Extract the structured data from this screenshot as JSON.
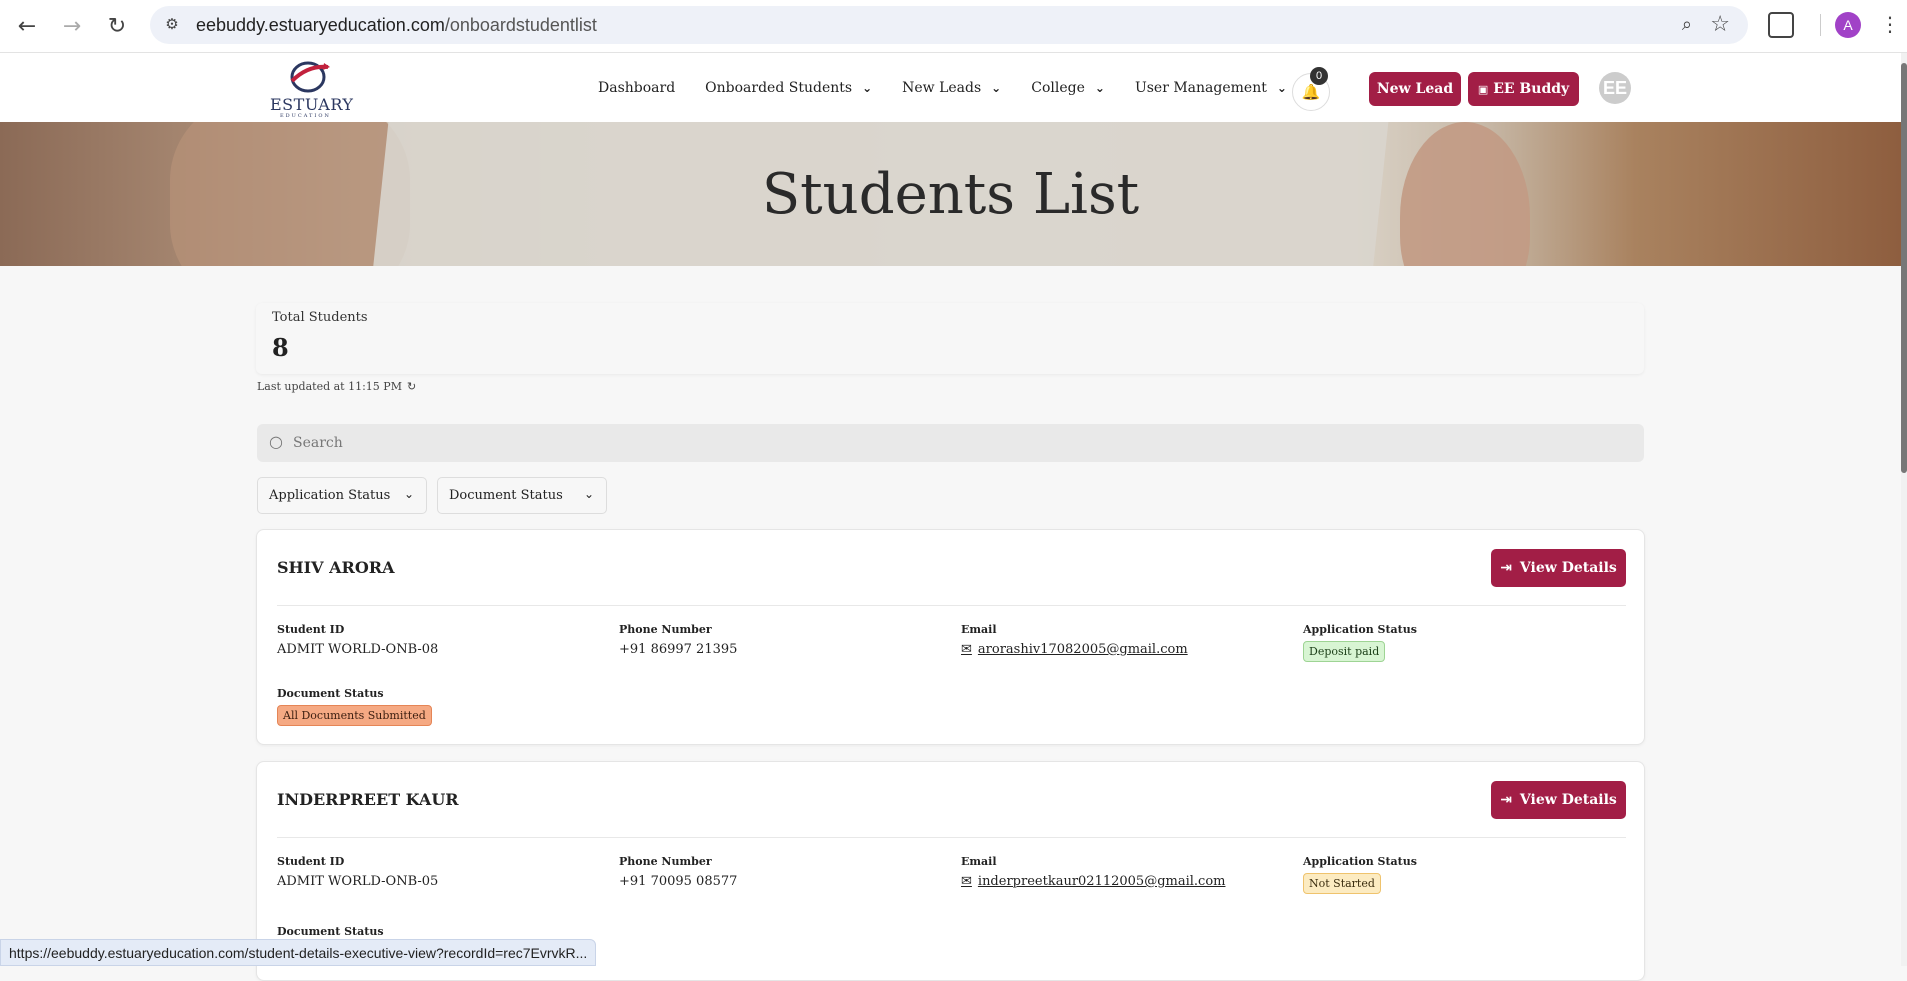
{
  "browser": {
    "url_domain": "eebuddy.estuaryeducation.com",
    "url_path": "/onboardstudentlist",
    "profile_initial": "A",
    "status_url": "https://eebuddy.estuaryeducation.com/student-details-executive-view?recordId=rec7EvrvkR..."
  },
  "header": {
    "logo_text": "ESTUARY",
    "logo_sub": "EDUCATION",
    "nav": [
      {
        "label": "Dashboard",
        "has_dropdown": false
      },
      {
        "label": "Onboarded Students",
        "has_dropdown": true
      },
      {
        "label": "New Leads",
        "has_dropdown": true
      },
      {
        "label": "College",
        "has_dropdown": true
      },
      {
        "label": "User Management",
        "has_dropdown": true
      }
    ],
    "notification_count": "0",
    "new_lead_label": "New Lead",
    "ee_buddy_label": "EE Buddy",
    "avatar_initials": "EE"
  },
  "hero": {
    "title": "Students List"
  },
  "stats": {
    "total_label": "Total Students",
    "total_value": "8",
    "last_updated": "Last updated at 11:15 PM"
  },
  "search": {
    "placeholder": "Search",
    "value": ""
  },
  "filters": {
    "application_status": "Application Status",
    "document_status": "Document Status"
  },
  "labels": {
    "student_id": "Student ID",
    "phone": "Phone Number",
    "email": "Email",
    "application_status": "Application Status",
    "document_status": "Document Status",
    "view_details": "View Details"
  },
  "students": [
    {
      "name": "SHIV ARORA",
      "student_id": "ADMIT WORLD-ONB-08",
      "phone": "+91 86997 21395",
      "email": "arorashiv17082005@gmail.com",
      "application_status": "Deposit paid",
      "document_status": "All Documents Submitted"
    },
    {
      "name": "INDERPREET KAUR",
      "student_id": "ADMIT WORLD-ONB-05",
      "phone": "+91 70095 08577",
      "email": "inderpreetkaur02112005@gmail.com",
      "application_status": "Not Started",
      "document_status": ""
    }
  ],
  "colors": {
    "brand": "#a21e46",
    "badge_green": "#d8f5d3",
    "badge_orange": "#f5a983",
    "badge_yellow": "#fcebc1"
  }
}
